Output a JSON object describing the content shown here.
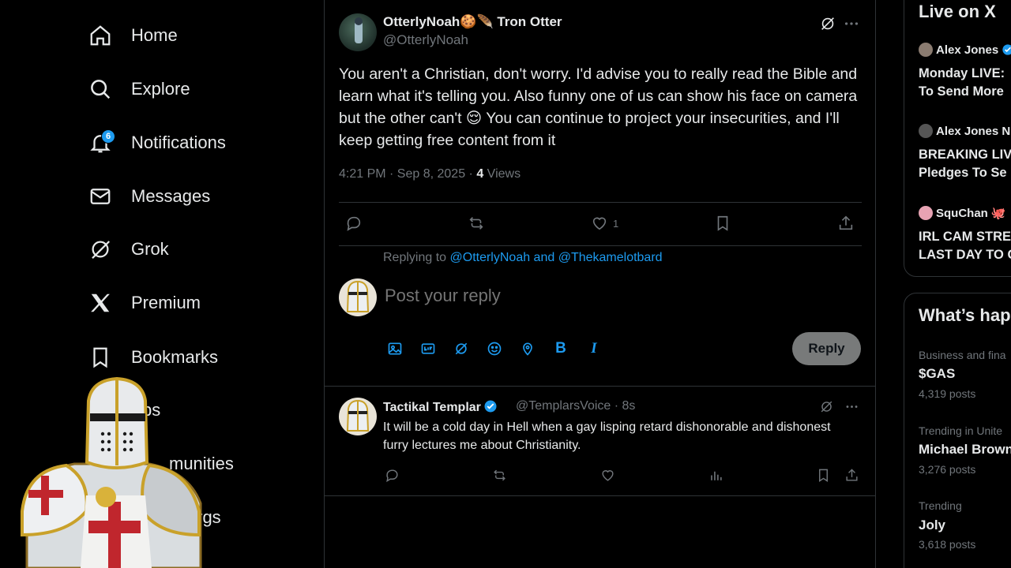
{
  "nav": {
    "items": [
      {
        "label": "Home",
        "icon": "home-icon"
      },
      {
        "label": "Explore",
        "icon": "search-icon"
      },
      {
        "label": "Notifications",
        "icon": "bell-icon",
        "badge": "6"
      },
      {
        "label": "Messages",
        "icon": "envelope-icon"
      },
      {
        "label": "Grok",
        "icon": "grok-icon"
      },
      {
        "label": "Premium",
        "icon": "x-logo-icon"
      },
      {
        "label": "Bookmarks",
        "icon": "bookmark-icon"
      },
      {
        "label": "bs",
        "icon": "jobs-icon"
      },
      {
        "label": "munities",
        "icon": "communities-icon"
      },
      {
        "label": "Orgs",
        "icon": "orgs-icon"
      }
    ]
  },
  "tweet": {
    "name": "OtterlyNoah🍪🪶 Tron Otter",
    "handle": "@OtterlyNoah",
    "body": "You aren't a Christian, don't worry. I'd advise you to really read the Bible and learn what it's telling you. Also funny one of us can show his face on camera but the other can't 😌 You can continue to project your insecurities, and I'll keep getting free content from it",
    "time": "4:21 PM · Sep 8, 2025 · ",
    "views_count": "4",
    "views_label": " Views",
    "like_count": "1"
  },
  "reply_box": {
    "replying_prefix": "Replying to ",
    "replying_to": "@OtterlyNoah and @Thekamelotbard",
    "placeholder": "Post your reply",
    "reply_button": "Reply",
    "tools": {
      "bold": "B",
      "italic": "I"
    }
  },
  "reply_tweet": {
    "name": "Tactikal Templar",
    "handle_time": "@TemplarsVoice · 8s",
    "body": "It will be a cold day in Hell when a gay lisping retard dishonorable and dishonest furry lectures me about Christianity."
  },
  "live": {
    "title": "Live on X",
    "items": [
      {
        "user": "Alex Jones",
        "title1": "Monday LIVE:",
        "title2": "To Send More",
        "dot": "#8a7b70"
      },
      {
        "user": "Alex Jones N",
        "title1": "BREAKING LIV",
        "title2": "Pledges To Se",
        "dot": "#555"
      },
      {
        "user": "SquChan",
        "title1": "IRL CAM STRE",
        "title2": "LAST DAY TO C",
        "dot": "#e7a3b3"
      }
    ]
  },
  "trends": {
    "title": "What’s hap",
    "items": [
      {
        "category": "Business and fina",
        "name": "$GAS",
        "count": "4,319 posts"
      },
      {
        "category": "Trending in Unite",
        "name": "Michael Brown",
        "count": "3,276 posts"
      },
      {
        "category": "Trending",
        "name": "Joly",
        "count": "3,618 posts"
      }
    ]
  },
  "colors": {
    "accent": "#1d9bf0",
    "muted": "#71767b",
    "border": "#2f3336",
    "background": "#000000"
  }
}
